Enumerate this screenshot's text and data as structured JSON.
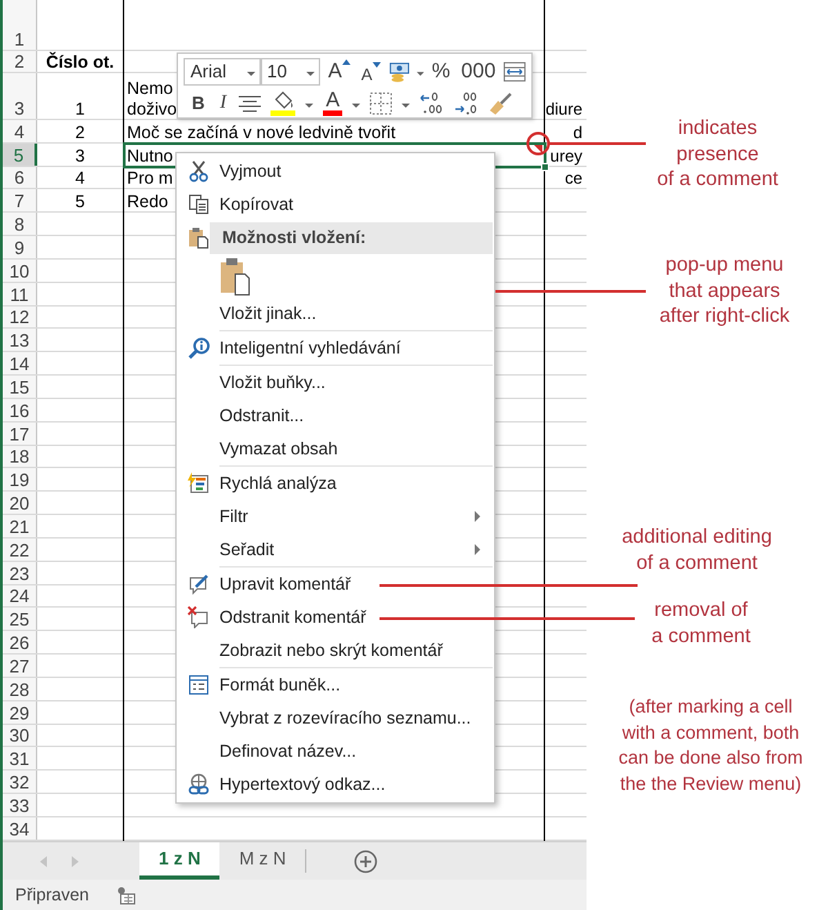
{
  "rows": [
    {
      "header": "1",
      "selected": false,
      "comment": false
    },
    {
      "header": "2",
      "column_a": "Číslo ot.",
      "selected": false,
      "comment": false
    },
    {
      "header": "3",
      "column_a": "1",
      "column_b": "Nemo\ndoživo",
      "column_c": "diure",
      "selected": false,
      "comment": false
    },
    {
      "header": "4",
      "column_a": "2",
      "column_b": "Moč se začíná v nové ledvině tvořit",
      "column_c": "d",
      "selected": false,
      "comment": false
    },
    {
      "header": "5",
      "column_a": "3",
      "column_b": "Nutno",
      "column_c": "urey",
      "selected": true,
      "comment": true
    },
    {
      "header": "6",
      "column_a": "4",
      "column_b": "Pro m",
      "column_c": "ce",
      "selected": false,
      "comment": false
    },
    {
      "header": "7",
      "column_a": "5",
      "column_b": "Redo",
      "selected": false,
      "comment": false
    },
    {
      "header": "8",
      "selected": false,
      "comment": false
    },
    {
      "header": "9",
      "selected": false,
      "comment": false
    },
    {
      "header": "10",
      "selected": false,
      "comment": false
    },
    {
      "header": "11",
      "selected": false,
      "comment": false
    },
    {
      "header": "12",
      "selected": false,
      "comment": false
    },
    {
      "header": "13",
      "selected": false,
      "comment": false
    },
    {
      "header": "14",
      "selected": false,
      "comment": false
    },
    {
      "header": "15",
      "selected": false,
      "comment": false
    },
    {
      "header": "16",
      "selected": false,
      "comment": false
    },
    {
      "header": "17",
      "selected": false,
      "comment": false
    },
    {
      "header": "18",
      "selected": false,
      "comment": false
    },
    {
      "header": "19",
      "selected": false,
      "comment": false
    },
    {
      "header": "20",
      "selected": false,
      "comment": false
    },
    {
      "header": "21",
      "selected": false,
      "comment": false
    },
    {
      "header": "22",
      "selected": false,
      "comment": false
    },
    {
      "header": "23",
      "selected": false,
      "comment": false
    },
    {
      "header": "24",
      "selected": false,
      "comment": false
    },
    {
      "header": "25",
      "selected": false,
      "comment": false
    },
    {
      "header": "26",
      "selected": false,
      "comment": false
    },
    {
      "header": "27",
      "selected": false,
      "comment": false
    },
    {
      "header": "28",
      "selected": false,
      "comment": false
    },
    {
      "header": "29",
      "selected": false,
      "comment": false
    },
    {
      "header": "30",
      "selected": false,
      "comment": false
    },
    {
      "header": "31",
      "selected": false,
      "comment": false
    },
    {
      "header": "32",
      "selected": false,
      "comment": false
    },
    {
      "header": "33",
      "selected": false,
      "comment": false
    },
    {
      "header": "34",
      "selected": false,
      "comment": false
    }
  ],
  "mini_toolbar": {
    "font": "Arial",
    "size": "10",
    "row_1": [
      {
        "kind": "grow",
        "label": "A"
      },
      {
        "kind": "shrink",
        "label": "A"
      },
      {
        "kind": "accounting"
      },
      {
        "kind": "text",
        "label": "%"
      },
      {
        "kind": "text",
        "label": "000"
      },
      {
        "kind": "wrap"
      }
    ],
    "row_2": [
      {
        "kind": "bold",
        "label": "B"
      },
      {
        "kind": "italic",
        "label": "I"
      },
      {
        "kind": "center"
      },
      {
        "kind": "fill"
      },
      {
        "kind": "font_color",
        "label": "A"
      },
      {
        "kind": "borders"
      },
      {
        "kind": "increase_decimal"
      },
      {
        "kind": "decrease_decimal"
      },
      {
        "kind": "painter"
      }
    ]
  },
  "context_menu": [
    {
      "kind": "item",
      "label": "Vyjmout",
      "submenu": false
    },
    {
      "kind": "item",
      "label": "Kopírovat",
      "submenu": false
    },
    {
      "kind": "header",
      "label": "Možnosti vložení:"
    },
    {
      "kind": "paste_options"
    },
    {
      "kind": "item",
      "label": "Vložit jinak...",
      "submenu": false
    },
    {
      "kind": "separator"
    },
    {
      "kind": "item",
      "label": "Inteligentní vyhledávání",
      "submenu": false
    },
    {
      "kind": "separator"
    },
    {
      "kind": "item",
      "label": "Vložit buňky...",
      "submenu": false
    },
    {
      "kind": "item",
      "label": "Odstranit...",
      "submenu": false
    },
    {
      "kind": "item",
      "label": "Vymazat obsah",
      "submenu": false
    },
    {
      "kind": "separator"
    },
    {
      "kind": "item",
      "label": "Rychlá analýza",
      "submenu": false
    },
    {
      "kind": "item",
      "label": "Filtr",
      "submenu": true
    },
    {
      "kind": "item",
      "label": "Seřadit",
      "submenu": true
    },
    {
      "kind": "separator"
    },
    {
      "kind": "item",
      "label": "Upravit komentář",
      "submenu": false
    },
    {
      "kind": "item",
      "label": "Odstranit komentář",
      "submenu": false
    },
    {
      "kind": "item",
      "label": "Zobrazit nebo skrýt komentář",
      "submenu": false
    },
    {
      "kind": "separator"
    },
    {
      "kind": "item",
      "label": "Formát buněk...",
      "submenu": false
    },
    {
      "kind": "item",
      "label": "Vybrat z rozevíracího seznamu...",
      "submenu": false
    },
    {
      "kind": "item",
      "label": "Definovat název...",
      "submenu": false
    },
    {
      "kind": "item",
      "label": "Hypertextový odkaz...",
      "submenu": false
    }
  ],
  "sheet_tabs": [
    {
      "label": "1 z N",
      "selected": true
    },
    {
      "label": "M z N",
      "selected": false
    }
  ],
  "status_bar": {
    "text": "Připraven"
  },
  "annotations": [
    {
      "text": "indicates\npresence\nof a comment"
    },
    {
      "text": "pop-up menu\nthat appears\nafter right-click"
    },
    {
      "text": "additional editing\nof a comment"
    },
    {
      "text": "removal of\na comment"
    },
    {
      "text": "(after marking a cell\nwith a comment, both\ncan be done also from\nthe the Review menu)"
    }
  ]
}
